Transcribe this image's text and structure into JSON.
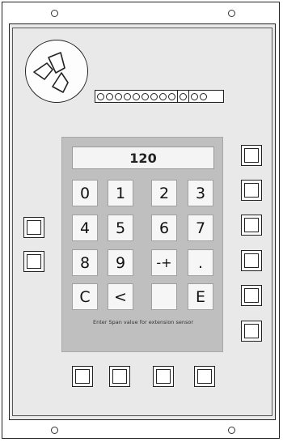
{
  "display": {
    "value": "120"
  },
  "keypad": {
    "rows": [
      [
        "0",
        "1",
        "2",
        "3"
      ],
      [
        "4",
        "5",
        "6",
        "7"
      ],
      [
        "8",
        "9",
        "-+",
        "."
      ],
      [
        "C",
        "<",
        "",
        "E"
      ]
    ],
    "hint": "Enter Span value for extension sensor"
  },
  "connector": {
    "pin_count": 12
  },
  "icons": {
    "speaker": "speaker-icon",
    "mount_hole": "mount-hole-icon"
  },
  "colors": {
    "panel": "#e9e9e9",
    "screen": "#bfbfbf",
    "key": "#f6f6f6",
    "outline": "#222222"
  }
}
